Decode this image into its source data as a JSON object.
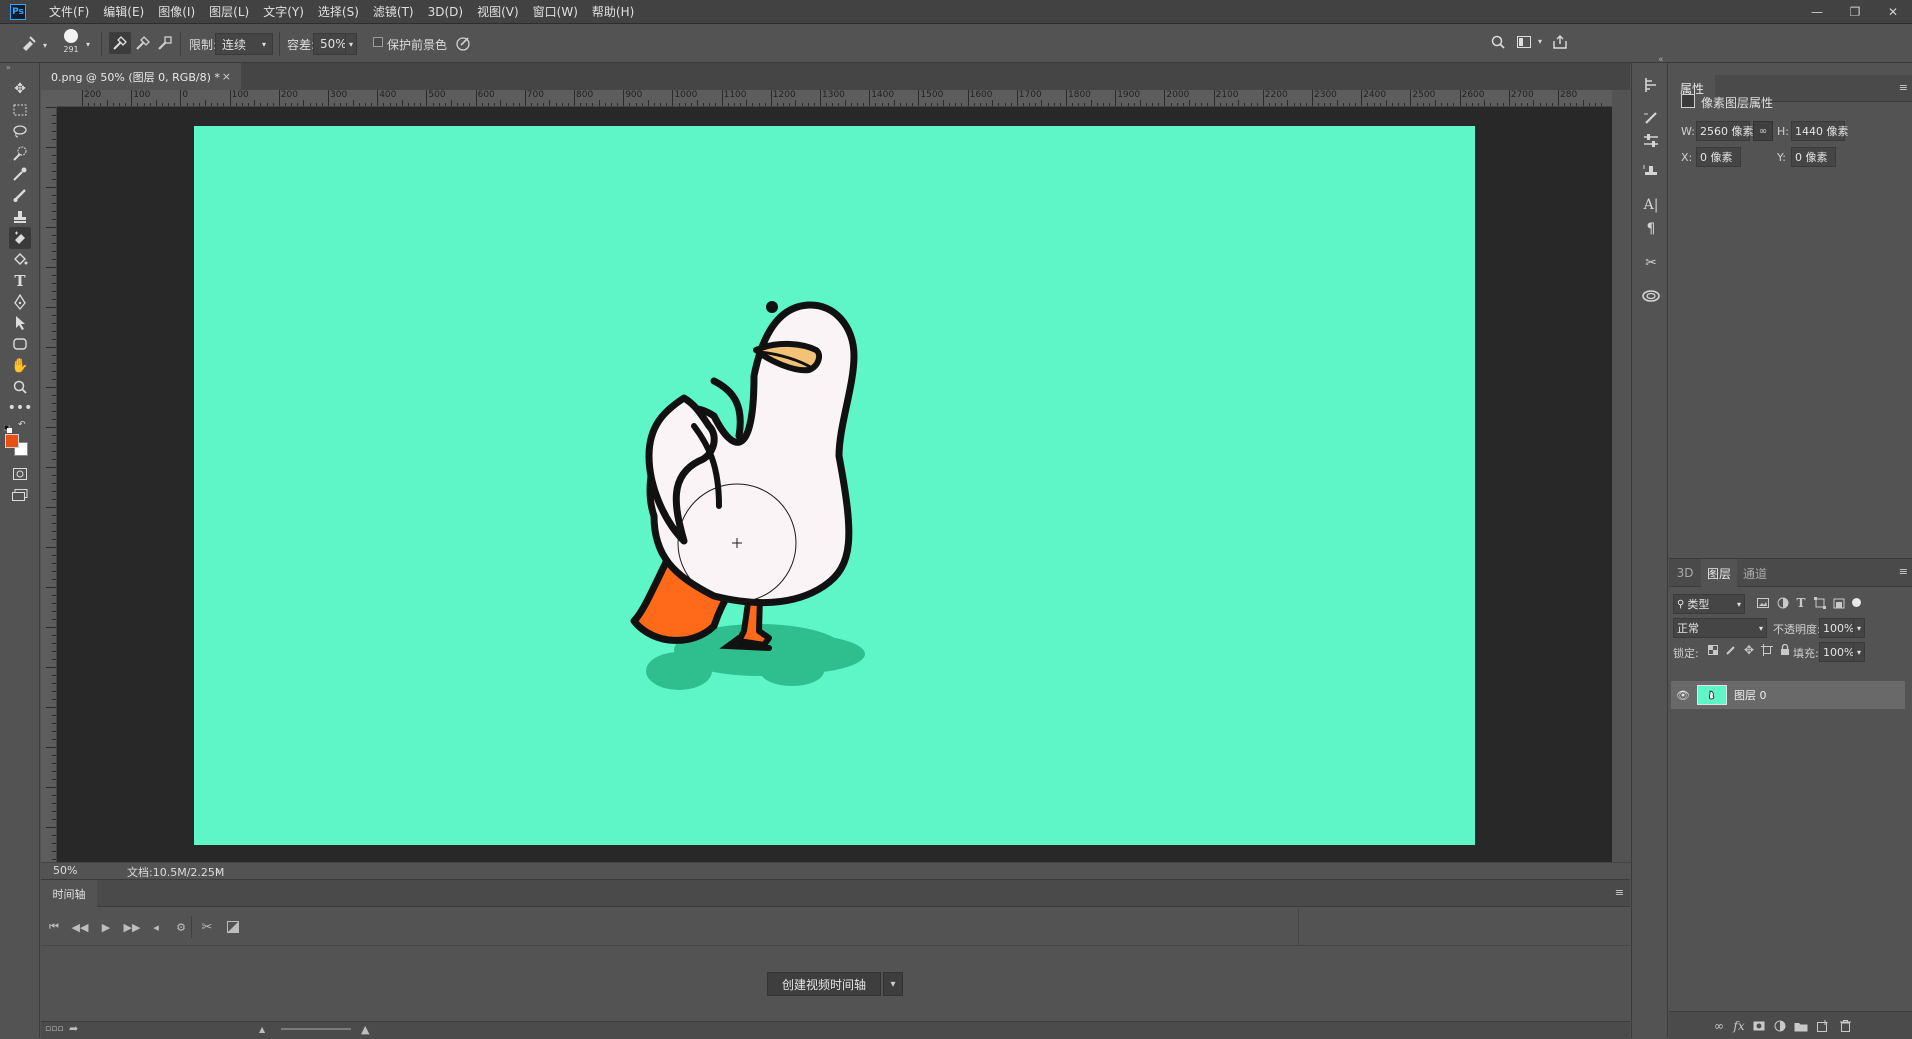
{
  "app": {
    "logo_text": "Ps"
  },
  "menu": [
    {
      "label": "文件(F)"
    },
    {
      "label": "编辑(E)"
    },
    {
      "label": "图像(I)"
    },
    {
      "label": "图层(L)"
    },
    {
      "label": "文字(Y)"
    },
    {
      "label": "选择(S)"
    },
    {
      "label": "滤镜(T)"
    },
    {
      "label": "3D(D)"
    },
    {
      "label": "视图(V)"
    },
    {
      "label": "窗口(W)"
    },
    {
      "label": "帮助(H)"
    }
  ],
  "options": {
    "brush_size": "291",
    "limit_label": "限制:",
    "limit_value": "连续",
    "tolerance_label": "容差:",
    "tolerance_value": "50%",
    "protect_fg_label": "保护前景色"
  },
  "colors": {
    "foreground": "#e8510f",
    "background": "#ffffff",
    "canvas": "#5ef6c7",
    "accent": "#31a8ff"
  },
  "document": {
    "tab_title": "0.png @ 50% (图层 0, RGB/8) *",
    "ruler_labels": [
      "200",
      "100",
      "0",
      "100",
      "200",
      "300",
      "400",
      "500",
      "600",
      "700",
      "800",
      "900",
      "1000",
      "1100",
      "1200",
      "1300",
      "1400",
      "1500",
      "1600",
      "1700",
      "1800",
      "1900",
      "2000",
      "2100",
      "2200",
      "2300",
      "2400",
      "2500",
      "2600",
      "2700",
      "280"
    ],
    "zoom": "50%",
    "doc_size": "文档:10.5M/2.25M"
  },
  "timeline": {
    "tab": "时间轴",
    "create_button": "创建视频时间轴"
  },
  "properties": {
    "tab": "属性",
    "section": "像素图层属性",
    "w_label": "W:",
    "w_value": "2560 像素",
    "h_label": "H:",
    "h_value": "1440 像素",
    "x_label": "X:",
    "x_value": "0 像素",
    "y_label": "Y:",
    "y_value": "0 像素"
  },
  "layers": {
    "tabs": [
      "3D",
      "图层",
      "通道"
    ],
    "filter_label": "类型",
    "blend_mode": "正常",
    "opacity_label": "不透明度:",
    "opacity_value": "100%",
    "lock_label": "锁定:",
    "fill_label": "填充:",
    "fill_value": "100%",
    "items": [
      {
        "name": "图层 0"
      }
    ]
  }
}
